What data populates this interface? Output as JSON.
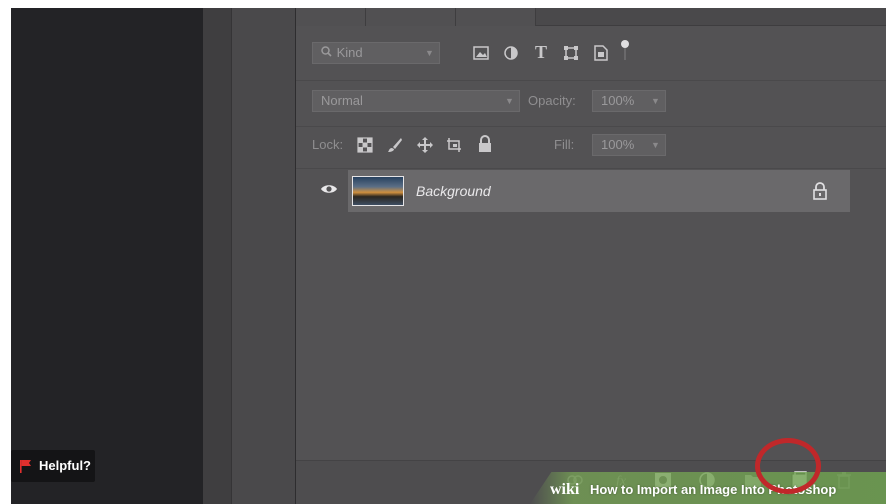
{
  "layers_panel": {
    "filter": {
      "placeholder": "Kind"
    },
    "blend_mode": {
      "value": "Normal"
    },
    "opacity": {
      "label": "Opacity:",
      "value": "100%"
    },
    "lock": {
      "label": "Lock:"
    },
    "fill": {
      "label": "Fill:",
      "value": "100%"
    },
    "layers": [
      {
        "name": "Background",
        "visible": true,
        "locked": true
      }
    ]
  },
  "helpful_badge": {
    "label": "Helpful?"
  },
  "watermark": {
    "logo": "wiki",
    "caption": "How to Import an Image Into Photoshop"
  },
  "colors": {
    "highlight_ring": "#c0282a",
    "watermark_green": "#7aa84f",
    "panel_bg": "#535254"
  }
}
